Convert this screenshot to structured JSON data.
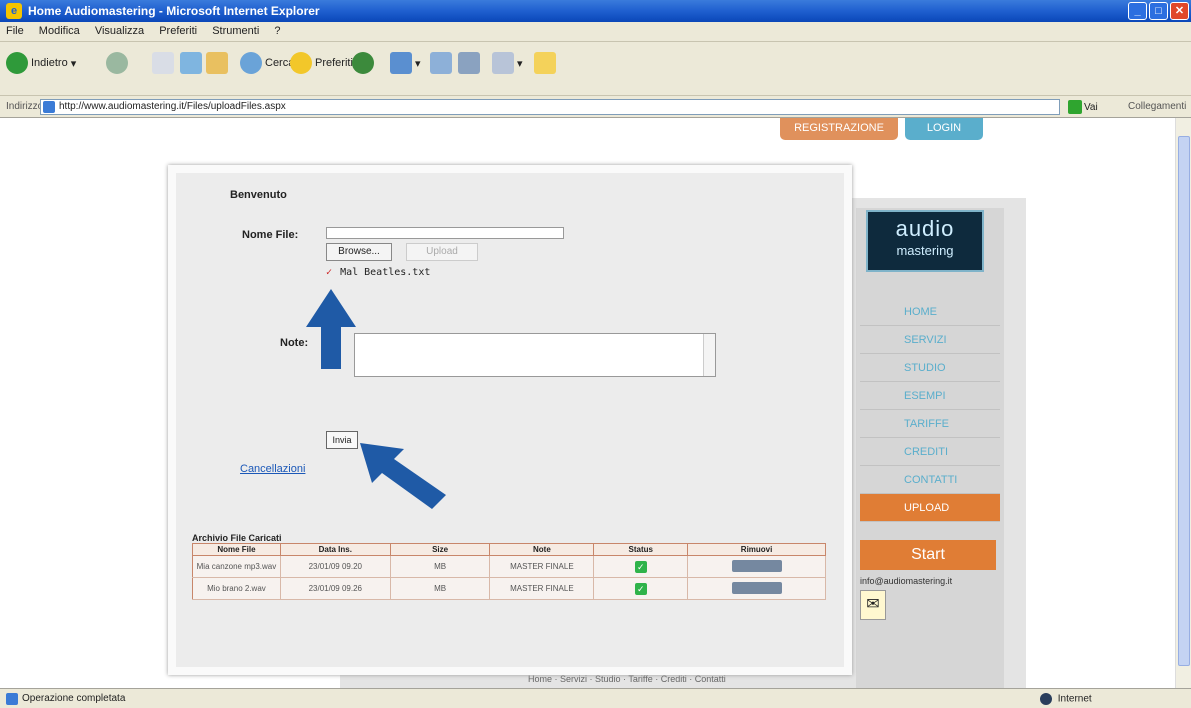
{
  "window": {
    "title": "Home Audiomastering - Microsoft Internet Explorer"
  },
  "menu": [
    "File",
    "Modifica",
    "Visualizza",
    "Preferiti",
    "Strumenti",
    "?"
  ],
  "toolbar": {
    "back": "Indietro",
    "search": "Cerca",
    "favorites": "Preferiti"
  },
  "address": {
    "label": "Indirizzo",
    "url": "http://www.audiomastering.it/Files/uploadFiles.aspx",
    "go": "Vai",
    "links": "Collegamenti"
  },
  "site": {
    "register_label": "REGISTRAZIONE",
    "login_label": "LOGIN",
    "logo_line1": "audio",
    "logo_line2": "mastering",
    "nav": [
      "HOME",
      "SERVIZI",
      "STUDIO",
      "ESEMPI",
      "TARIFFE",
      "CREDITI",
      "CONTATTI",
      "UPLOAD"
    ],
    "start_label": "Start",
    "mail_text": "info@audiomastering.it",
    "footer": "Home · Servizi · Studio · Tariffe · Crediti · Contatti"
  },
  "upload": {
    "welcome": "Benvenuto",
    "file_label": "Nome File:",
    "browse_label": "Browse...",
    "upload_label": "Upload",
    "chosen_file": "Mal Beatles.txt",
    "notes_label": "Note:",
    "send_label": "Invia",
    "cancel_label": "Cancellazioni",
    "table_title": "Archivio File Caricati",
    "columns": [
      "Nome File",
      "Data Ins.",
      "Size",
      "Note",
      "Status",
      "Rimuovi"
    ],
    "rows": [
      {
        "name": "Mia canzone mp3.wav",
        "date": "23/01/09 09.20",
        "size": "MB",
        "note": "MASTER FINALE",
        "status": "ok"
      },
      {
        "name": "Mio brano 2.wav",
        "date": "23/01/09 09.26",
        "size": "MB",
        "note": "MASTER FINALE",
        "status": "ok"
      }
    ]
  },
  "status": {
    "text": "Operazione completata",
    "zone": "Internet"
  },
  "colors": {
    "accent_orange": "#e07d35",
    "accent_blue": "#5aaecc",
    "arrow_blue": "#1f5aa6"
  }
}
